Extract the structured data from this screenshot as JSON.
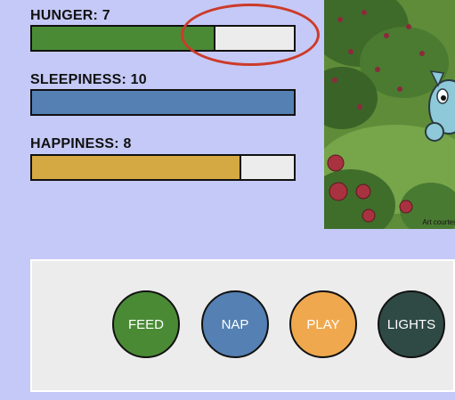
{
  "stats": [
    {
      "label": "HUNGER: 7",
      "value": 7,
      "max": 10,
      "color": "#4a8a35"
    },
    {
      "label": "SLEEPINESS: 10",
      "value": 10,
      "max": 10,
      "color": "#5480b3"
    },
    {
      "label": "HAPPINESS: 8",
      "value": 8,
      "max": 10,
      "color": "#d4a843"
    }
  ],
  "highlight_color": "#cc3b2a",
  "art": {
    "credit": "Art courtesy"
  },
  "actions": [
    {
      "label": "FEED",
      "color": "#4a8a35"
    },
    {
      "label": "NAP",
      "color": "#5480b3"
    },
    {
      "label": "PLAY",
      "color": "#f0a84e"
    },
    {
      "label": "LIGHTS",
      "color": "#2f4a44"
    }
  ]
}
